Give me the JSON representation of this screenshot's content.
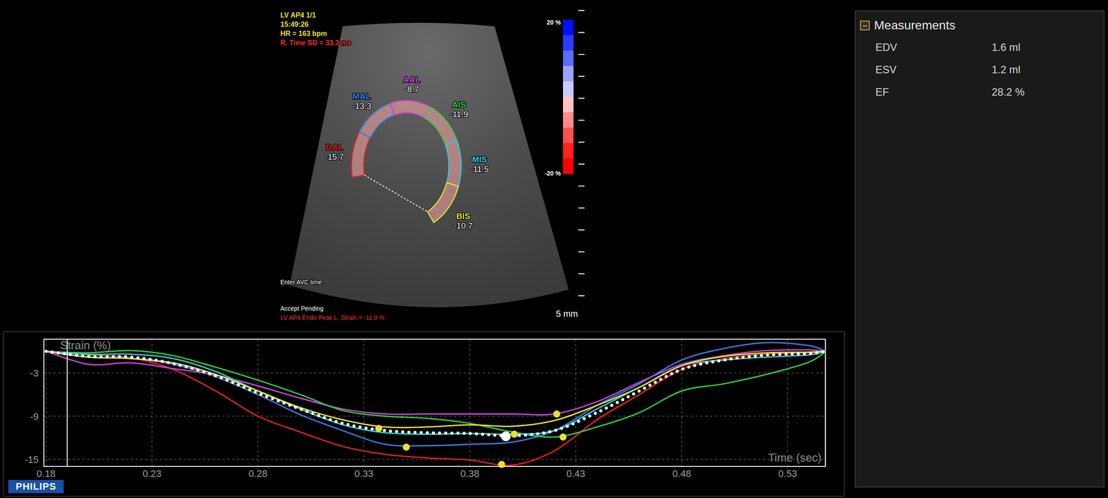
{
  "viewer": {
    "info_lines": [
      {
        "text": "LV AP4 1/1",
        "color": "#e8e030"
      },
      {
        "text": "15:49:26",
        "color": "#e8e030"
      },
      {
        "text": "HR = 163 bpm",
        "color": "#e8e030"
      },
      {
        "text": "R. Time SD = 33.3 ms",
        "color": "#ff2a2a"
      }
    ],
    "hint": "Enter AVC time.",
    "status": "Accept Pending",
    "result": "LV AP4 Endo Peak L. Strain = -11.8 %",
    "scale_label": "5 mm",
    "color_bar": {
      "max": "20 %",
      "min": "-20 %"
    }
  },
  "segments": [
    {
      "name": "DAL",
      "value": "-15.7",
      "color": "#e82020",
      "values": [
        0,
        -0.5,
        -0.9,
        -2.5,
        -5.5,
        -9.0,
        -11.2,
        -13.2,
        -14.3,
        -14.8,
        -15.1,
        -15.8,
        -13.8,
        -9.5,
        -6.0,
        -2.5,
        -1.0,
        -0.4,
        -0.2,
        0
      ],
      "peak": {
        "time": 0.395,
        "value": -15.7
      }
    },
    {
      "name": "MAL",
      "value": "-13.3",
      "color": "#2f80e8",
      "values": [
        0,
        -0.8,
        -1.0,
        -1.8,
        -3.5,
        -6.0,
        -8.8,
        -11.0,
        -12.9,
        -13.1,
        -12.9,
        -12.6,
        -11.0,
        -7.5,
        -4.5,
        -1.2,
        0.4,
        1.2,
        0.8,
        0
      ],
      "peak": {
        "time": 0.35,
        "value": -13.3
      }
    },
    {
      "name": "AAL",
      "value": "-8.7",
      "color": "#d040e0",
      "values": [
        0,
        -1.8,
        -1.6,
        -2.4,
        -3.3,
        -4.8,
        -6.5,
        -8.0,
        -8.7,
        -8.7,
        -8.7,
        -8.7,
        -8.7,
        -7.0,
        -4.3,
        -1.8,
        -0.6,
        0.1,
        0.2,
        0
      ],
      "peak": {
        "time": 0.421,
        "value": -8.7
      }
    },
    {
      "name": "AIS",
      "value": "-11.9",
      "color": "#30d040",
      "values": [
        0,
        -0.2,
        0.1,
        -0.6,
        -2.2,
        -4.0,
        -6.0,
        -8.2,
        -9.0,
        -9.3,
        -10.0,
        -11.2,
        -11.9,
        -10.5,
        -8.5,
        -5.5,
        -4.5,
        -3.2,
        -1.5,
        0
      ],
      "peak": {
        "time": 0.424,
        "value": -11.9
      }
    },
    {
      "name": "MIS",
      "value": "-11.5",
      "color": "#20d0e0",
      "values": [
        0,
        -0.4,
        -0.4,
        -1.0,
        -2.8,
        -5.5,
        -8.0,
        -10.2,
        -11.3,
        -11.5,
        -11.4,
        -11.5,
        -11.0,
        -8.0,
        -5.0,
        -2.0,
        -1.2,
        -0.8,
        -0.5,
        0
      ],
      "peak": {
        "time": 0.401,
        "value": -11.5
      }
    },
    {
      "name": "BIS",
      "value": "-10.7",
      "color": "#e8e030",
      "values": [
        0,
        -0.8,
        -1.0,
        -1.6,
        -3.2,
        -5.5,
        -7.8,
        -9.5,
        -10.5,
        -10.5,
        -10.2,
        -10.4,
        -9.6,
        -7.5,
        -5.0,
        -2.0,
        -0.7,
        -0.2,
        -0.1,
        0
      ],
      "peak": {
        "time": 0.337,
        "value": -10.7
      }
    }
  ],
  "chart": {
    "y_label": "Strain (%)",
    "x_label": "Time (sec)",
    "y_ticks": [
      "-3",
      "-9",
      "-15"
    ],
    "x_ticks": [
      "0.18",
      "0.23",
      "0.28",
      "0.33",
      "0.38",
      "0.43",
      "0.48",
      "0.53"
    ],
    "times": [
      0.18,
      0.2,
      0.22,
      0.24,
      0.26,
      0.28,
      0.3,
      0.32,
      0.34,
      0.36,
      0.38,
      0.4,
      0.42,
      0.44,
      0.46,
      0.48,
      0.5,
      0.52,
      0.54,
      0.548
    ],
    "cursor_time": 0.19,
    "average": {
      "color": "#ffffff",
      "values": [
        0,
        -0.7,
        -0.8,
        -1.7,
        -3.4,
        -5.8,
        -8.0,
        -10.0,
        -11.0,
        -11.3,
        -11.4,
        -11.7,
        -11.0,
        -8.5,
        -5.5,
        -2.5,
        -1.2,
        -0.5,
        -0.3,
        0
      ],
      "peak": {
        "time": 0.397,
        "value": -11.8
      }
    }
  },
  "measurements": {
    "title": "Measurements",
    "toggle": "−",
    "expanded": true,
    "items": [
      {
        "label": "EDV",
        "value": "1.6 ml"
      },
      {
        "label": "ESV",
        "value": "1.2 ml"
      },
      {
        "label": "EF",
        "value": "28.2 %"
      }
    ]
  },
  "logo": "PHILIPS"
}
